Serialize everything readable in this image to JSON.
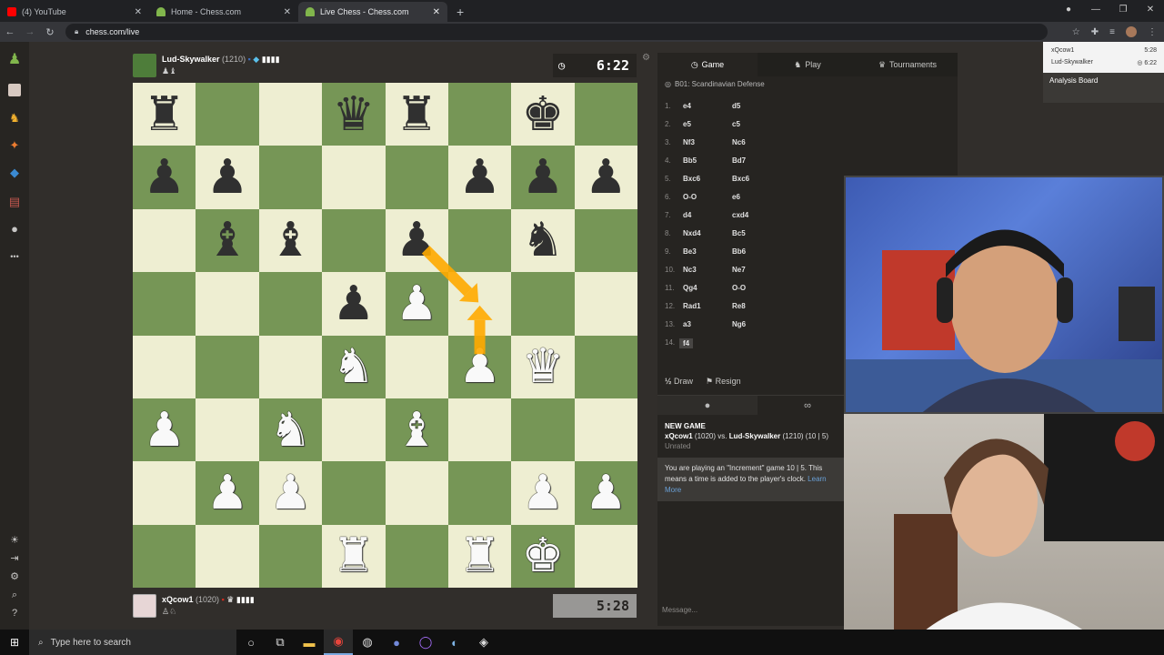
{
  "browser": {
    "tabs": [
      {
        "title": "(4) YouTube",
        "fav_color": "#ff0000"
      },
      {
        "title": "Home - Chess.com",
        "fav_color": "#81b64c"
      },
      {
        "title": "Live Chess - Chess.com",
        "fav_color": "#81b64c"
      }
    ],
    "new_tab": "+",
    "url": "chess.com/live"
  },
  "sidebar": {
    "icons": [
      "pawn-icon",
      "news-icon",
      "puzzle-icon",
      "lessons-icon",
      "learn-icon",
      "cards-icon",
      "chat-icon",
      "more-icon"
    ],
    "bottom_icons": [
      "brightness-icon",
      "logout-icon",
      "settings-icon",
      "search-icon",
      "help-icon"
    ],
    "more_glyph": "•••"
  },
  "top_player": {
    "name": "Lud-Skywalker",
    "rating": "(1210)",
    "captured": "♟♝",
    "clock": "6:22"
  },
  "bottom_player": {
    "name": "xQcow1",
    "rating": "(1020)",
    "captured": "♙♘",
    "clock": "5:28"
  },
  "board": {
    "ranks": [
      [
        "bR",
        "",
        "",
        "bQ",
        "bR",
        "",
        "bK",
        ""
      ],
      [
        "bP",
        "bP",
        "",
        "",
        "",
        "bP",
        "bP",
        "bP"
      ],
      [
        "",
        "bB",
        "bB",
        "",
        "bP",
        "",
        "bN",
        ""
      ],
      [
        "",
        "",
        "",
        "bP",
        "wP",
        "",
        "",
        ""
      ],
      [
        "",
        "",
        "",
        "wN",
        "",
        "wP",
        "wQ",
        ""
      ],
      [
        "wP",
        "",
        "wN",
        "",
        "wB",
        "",
        "",
        ""
      ],
      [
        "",
        "wP",
        "wP",
        "",
        "",
        "",
        "wP",
        "wP"
      ],
      [
        "",
        "",
        "",
        "wR",
        "",
        "wR",
        "wK",
        ""
      ]
    ],
    "arrow_color": "#ffaa00"
  },
  "panel": {
    "tabs": [
      {
        "label": "Game",
        "icon": "game-icon"
      },
      {
        "label": "Play",
        "icon": "play-icon"
      },
      {
        "label": "Tournaments",
        "icon": "trophy-icon"
      }
    ],
    "opening": "B01: Scandinavian Defense",
    "moves": [
      {
        "n": "1.",
        "w": "e4",
        "b": "d5"
      },
      {
        "n": "2.",
        "w": "e5",
        "b": "c5"
      },
      {
        "n": "3.",
        "w": "Nf3",
        "b": "Nc6"
      },
      {
        "n": "4.",
        "w": "Bb5",
        "b": "Bd7"
      },
      {
        "n": "5.",
        "w": "Bxc6",
        "b": "Bxc6"
      },
      {
        "n": "6.",
        "w": "O-O",
        "b": "e6"
      },
      {
        "n": "7.",
        "w": "d4",
        "b": "cxd4"
      },
      {
        "n": "8.",
        "w": "Nxd4",
        "b": "Bc5"
      },
      {
        "n": "9.",
        "w": "Be3",
        "b": "Bb6"
      },
      {
        "n": "10.",
        "w": "Nc3",
        "b": "Ne7"
      },
      {
        "n": "11.",
        "w": "Qg4",
        "b": "O-O"
      },
      {
        "n": "12.",
        "w": "Rad1",
        "b": "Re8"
      },
      {
        "n": "13.",
        "w": "a3",
        "b": "Ng6"
      },
      {
        "n": "14.",
        "w": "f4",
        "b": ""
      }
    ],
    "draw_label": "Draw",
    "draw_glyph": "½",
    "resign_label": "Resign",
    "chat": {
      "new_game": "NEW GAME",
      "white": "xQcow1",
      "white_rating": "(1020) vs.",
      "black": "Lud-Skywalker",
      "black_rating": "(1210) (10 | 5)",
      "rated": "Unrated",
      "notice": "You are playing an \"Increment\" game 10 | 5. This means a time is added to the player's clock.",
      "learn_more": "Learn More"
    },
    "message_placeholder": "Message..."
  },
  "popup": {
    "row1_name": "xQcow1",
    "row1_time": "5:28",
    "row2_name": "Lud-Skywalker",
    "row2_time": "◎ 6:22",
    "analysis": "Analysis Board"
  },
  "taskbar": {
    "search_placeholder": "Type here to search"
  }
}
